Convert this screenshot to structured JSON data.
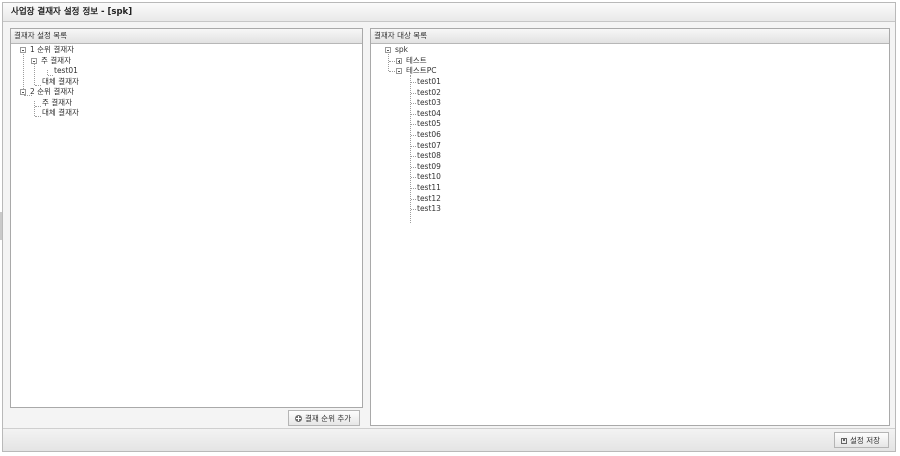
{
  "window": {
    "title": "사업장 결재자 설정 정보 - [spk]"
  },
  "left_panel": {
    "header": "결재자 설정 목록",
    "tree": {
      "rank1": "1 순위 결재자",
      "rank1_main": "주 결재자",
      "rank1_main_child": "test01",
      "rank1_alt": "대체 결재자",
      "rank2": "2 순위 결재자",
      "rank2_main": "주 결재자",
      "rank2_alt": "대체 결재자"
    },
    "add_button": "결재 순위 추가"
  },
  "right_panel": {
    "header": "결재자 대상 목록",
    "tree": {
      "root": "spk",
      "group1": "테스트",
      "group2": "테스트PC",
      "users": [
        "test01",
        "test02",
        "test03",
        "test04",
        "test05",
        "test06",
        "test07",
        "test08",
        "test09",
        "test10",
        "test11",
        "test12",
        "test13"
      ]
    }
  },
  "footer": {
    "save_button": "설정 저장"
  }
}
